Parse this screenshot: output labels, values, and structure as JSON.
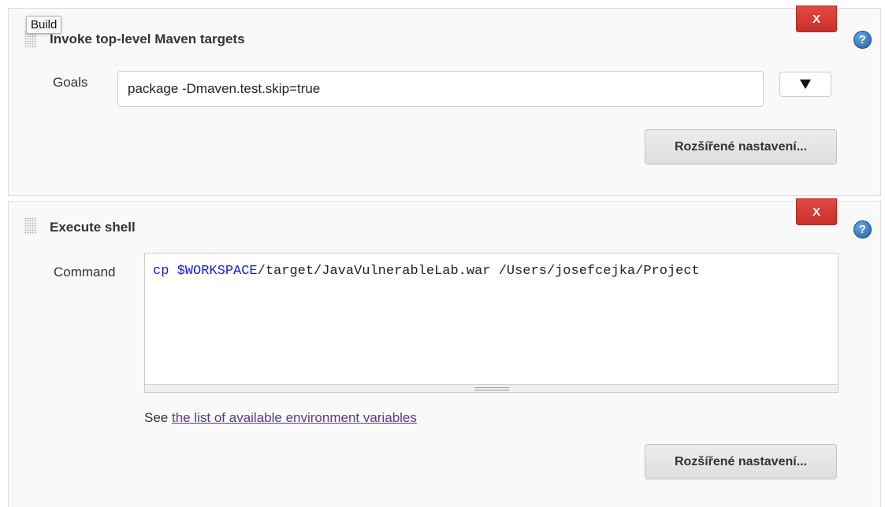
{
  "tooltip": {
    "text": "Build"
  },
  "maven_step": {
    "title": "Invoke top-level Maven targets",
    "delete_label": "X",
    "goals_label": "Goals",
    "goals_value": "package -Dmaven.test.skip=true",
    "advanced_label": "Rozšířené nastavení..."
  },
  "shell_step": {
    "title": "Execute shell",
    "delete_label": "X",
    "command_label": "Command",
    "command_prefix": "cp ",
    "command_variable": "$WORKSPACE",
    "command_rest": "/target/JavaVulnerableLab.war /Users/josefcejka/Project",
    "see_text": "See ",
    "env_link_text": "the list of available environment variables",
    "advanced_label": "Rozšířené nastavení..."
  },
  "help": {
    "symbol": "?"
  },
  "icons": {
    "drag": "drag-handle-icon",
    "help": "help-icon",
    "dropdown": "chevron-down-icon"
  },
  "colors": {
    "delete": "#d9433a",
    "help": "#2a6fbd",
    "link": "#5a3a87",
    "variable": "#1a1adb"
  }
}
